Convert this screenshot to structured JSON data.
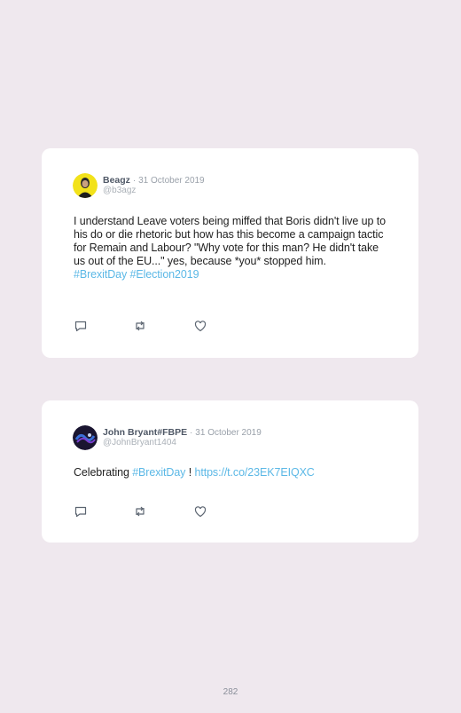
{
  "tweets": [
    {
      "author_name": "Beagz",
      "separator": "·",
      "date": "31 October 2019",
      "handle": "@b3agz",
      "text": "I understand Leave voters being miffed that Boris didn't live up to his do or die rhetoric but how has this become a campaign tactic for Remain and Labour? \"Why vote for this man? He didn't take us out of the EU...\" yes, because *you* stopped him.",
      "hashtags": [
        "#BrexitDay",
        "#Election2019"
      ],
      "avatar_color": "#f2e21a"
    },
    {
      "author_name": "John Bryant#FBPE",
      "separator": "·",
      "date": "31 October 2019",
      "handle": "@JohnBryant1404",
      "text_prefix": "Celebrating ",
      "hashtag": "#BrexitDay",
      "text_mid": " ! ",
      "url": "https://t.co/23EK7EIQXC",
      "avatar_color": "#1a1530"
    }
  ],
  "actions": {
    "reply_icon": "reply-icon",
    "retweet_icon": "retweet-icon",
    "like_icon": "heart-icon"
  },
  "colors": {
    "background": "#efe8ee",
    "link": "#5bb8e6"
  },
  "page_number": "282"
}
